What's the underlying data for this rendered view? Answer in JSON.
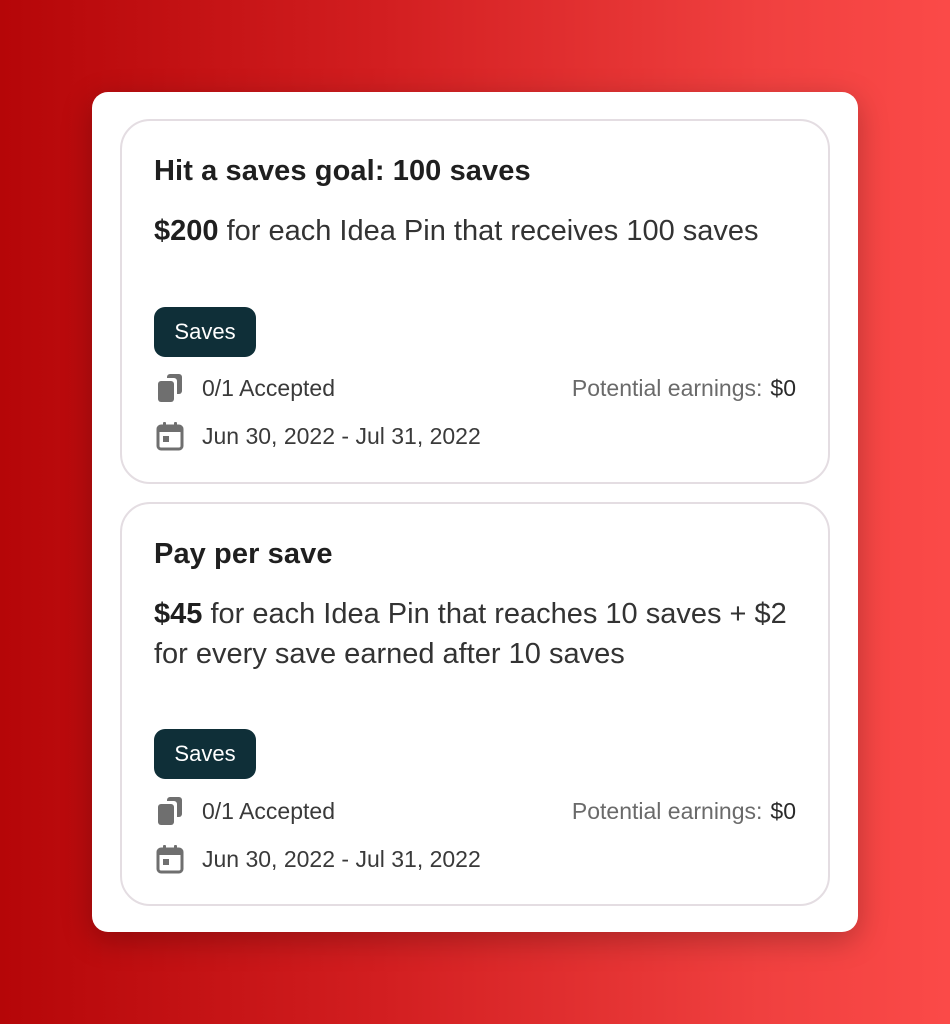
{
  "cards": [
    {
      "title": "Hit a saves goal: 100 saves",
      "amount": "$200",
      "description": " for each Idea Pin that receives 100 saves",
      "tag": "Saves",
      "accepted": "0/1 Accepted",
      "earnings_label": "Potential earnings:",
      "earnings_value": "$0",
      "date_range": "Jun 30, 2022 - Jul 31, 2022"
    },
    {
      "title": "Pay per save",
      "amount": "$45",
      "description": " for each Idea Pin that reaches 10 saves + $2 for every save earned after 10 saves",
      "tag": "Saves",
      "accepted": "0/1 Accepted",
      "earnings_label": "Potential earnings:",
      "earnings_value": "$0",
      "date_range": "Jun 30, 2022 - Jul 31, 2022"
    }
  ],
  "icons": {
    "accepted": "stacked-pins-icon",
    "date": "calendar-icon"
  },
  "colors": {
    "tag_background": "#0f2f38",
    "background_start": "#b50608",
    "background_end": "#fb4a48"
  }
}
